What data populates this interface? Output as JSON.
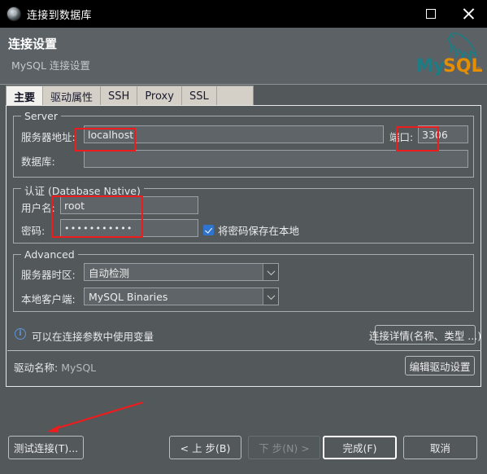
{
  "window": {
    "title": "连接到数据库",
    "icon": "app-icon",
    "buttons": {
      "maximize": "maximize-icon",
      "close": "close-icon"
    }
  },
  "header": {
    "title": "连接设置",
    "subtitle": "MySQL 连接设置",
    "logo_text_1": "My",
    "logo_text_2": "SQL",
    "logo_mark": "®",
    "logo_color_teal": "#1d7d84",
    "logo_color_orange": "#e48e00"
  },
  "tabs": [
    {
      "label": "主要",
      "active": true
    },
    {
      "label": "驱动属性",
      "active": false
    },
    {
      "label": "SSH",
      "active": false
    },
    {
      "label": "Proxy",
      "active": false
    },
    {
      "label": "SSL",
      "active": false
    }
  ],
  "server_group": {
    "title": "Server",
    "host_label": "服务器地址:",
    "host_value": "localhost",
    "port_label": "端口:",
    "port_value": "3306",
    "database_label": "数据库:",
    "database_value": ""
  },
  "auth_group": {
    "title": "认证 (Database Native)",
    "username_label": "用户名:",
    "username_value": "root",
    "password_label": "密码:",
    "password_value": "•••••••••••",
    "save_password_label": "将密码保存在本地",
    "save_password_checked": true
  },
  "advanced_group": {
    "title": "Advanced",
    "timezone_label": "服务器时区:",
    "timezone_value": "自动检测",
    "client_label": "本地客户端:",
    "client_value": "MySQL Binaries"
  },
  "info": {
    "icon": "info-icon",
    "text": "可以在连接参数中使用变量",
    "details_button": "连接详情(名称、类型 ...)"
  },
  "driver": {
    "label": "驱动名称:",
    "value": "MySQL",
    "edit_button": "编辑驱动设置"
  },
  "footer": {
    "test_connection": "测试连接(T)...",
    "back": "< 上  步(B)",
    "next": "下  步(N) >",
    "finish": "完成(F)",
    "cancel": "取消"
  },
  "annotations": {
    "highlight_color": "#ee1c1c",
    "boxes": [
      "host-field",
      "port-field",
      "username-password-fields"
    ],
    "arrow": "points-to-test-connection-button"
  }
}
